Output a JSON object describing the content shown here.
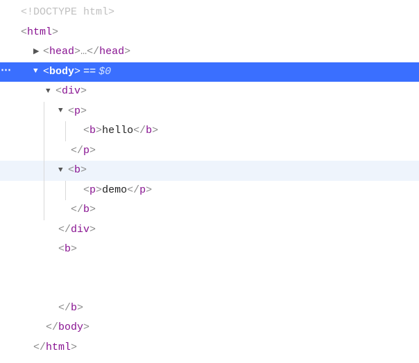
{
  "editor": {
    "doctype": "<!DOCTYPE html>",
    "htmlOpen": {
      "lt": "<",
      "tag": "html",
      "gt": ">"
    },
    "headCollapsed": {
      "lt1": "<",
      "tagOpen": "head",
      "gt1": ">",
      "ellipsis": "…",
      "lt2": "</",
      "tagClose": "head",
      "gt2": ">"
    },
    "bodyOpen": {
      "lt": "<",
      "tag": "body",
      "gt": ">",
      "eq": "==",
      "sel": "$0"
    },
    "divOpen": {
      "lt": "<",
      "tag": "div",
      "gt": ">"
    },
    "p1Open": {
      "lt": "<",
      "tag": "p",
      "gt": ">"
    },
    "bHello": {
      "lt1": "<",
      "tagOpen": "b",
      "gt1": ">",
      "text": "hello",
      "lt2": "</",
      "tagClose": "b",
      "gt2": ">"
    },
    "p1Close": {
      "lt": "</",
      "tag": "p",
      "gt": ">"
    },
    "b2Open": {
      "lt": "<",
      "tag": "b",
      "gt": ">"
    },
    "pDemo": {
      "lt1": "<",
      "tagOpen": "p",
      "gt1": ">",
      "text": "demo",
      "lt2": "</",
      "tagClose": "p",
      "gt2": ">"
    },
    "b2Close": {
      "lt": "</",
      "tag": "b",
      "gt": ">"
    },
    "divClose": {
      "lt": "</",
      "tag": "div",
      "gt": ">"
    },
    "b3Open": {
      "lt": "<",
      "tag": "b",
      "gt": ">"
    },
    "b3Close": {
      "lt": "</",
      "tag": "b",
      "gt": ">"
    },
    "bodyClose": {
      "lt": "</",
      "tag": "body",
      "gt": ">"
    },
    "htmlClose": {
      "lt": "</",
      "tag": "html",
      "gt": ">"
    }
  },
  "indents": {
    "d0": "",
    "d1": "  ",
    "d2": "    ",
    "d3": "      ",
    "d4": "        ",
    "d5": "          "
  }
}
